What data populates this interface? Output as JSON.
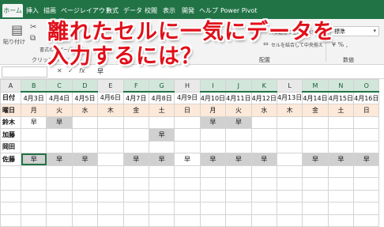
{
  "ribbon": {
    "tabs": [
      "ホーム",
      "挿入",
      "描画",
      "ページレイアウト",
      "数式",
      "データ",
      "校閲",
      "表示",
      "開発",
      "ヘルプ",
      "Power Pivot"
    ],
    "active_tab": "ホーム",
    "paste_label": "貼り付け",
    "format_copy_label": "書式のコピー/貼り付け",
    "clipboard_group": "クリップボード",
    "wrap_label": "折り返して全体を表示する",
    "merge_label": "セルを結合して中央揃え",
    "align_group": "配置",
    "number_format": "標準",
    "number_group": "数値"
  },
  "formula_bar": {
    "name_box": "",
    "value": "早"
  },
  "headline": {
    "line1": "離れたセルに一気にデータを",
    "line2": "入力するには？"
  },
  "sheet": {
    "column_headers": [
      "A",
      "B",
      "C",
      "D",
      "E",
      "F",
      "G",
      "H",
      "I",
      "J",
      "K",
      "L",
      "M",
      "N",
      "O"
    ],
    "selected_columns": [
      "B",
      "C",
      "D",
      "F",
      "G",
      "I",
      "J",
      "K",
      "M",
      "N",
      "O"
    ],
    "row_labels": [
      "日付",
      "曜日",
      "鈴木",
      "加藤",
      "岡田",
      "佐藤"
    ],
    "dates": [
      "4月3日",
      "4月4日",
      "4月5日",
      "4月6日",
      "4月7日",
      "4月8日",
      "4月9日",
      "4月10日",
      "4月11日",
      "4月12日",
      "4月13日",
      "4月14日",
      "4月15日",
      "4月16日"
    ],
    "weekdays": [
      "月",
      "火",
      "水",
      "木",
      "金",
      "土",
      "日",
      "月",
      "火",
      "水",
      "木",
      "金",
      "土",
      "日"
    ],
    "people": [
      [
        "早",
        "早",
        "",
        "",
        "",
        "",
        "",
        "早",
        "早",
        "",
        "",
        "",
        "",
        ""
      ],
      [
        "",
        "",
        "",
        "",
        "",
        "早",
        "",
        "",
        "",
        "",
        "",
        "",
        "",
        ""
      ],
      [
        "",
        "",
        "",
        "",
        "",
        "",
        "",
        "",
        "",
        "",
        "",
        "",
        "",
        ""
      ],
      [
        "早",
        "早",
        "早",
        "",
        "早",
        "早",
        "早",
        "早",
        "早",
        "早",
        "",
        "早",
        "早",
        "早"
      ]
    ],
    "gray_cells": {
      "鈴木": [
        1,
        7,
        8
      ],
      "加藤": [
        5
      ],
      "佐藤": [
        0,
        1,
        2,
        4,
        5,
        7,
        8,
        9,
        11,
        12,
        13
      ]
    },
    "active_cell": "佐藤-0"
  },
  "colors": {
    "excel_green": "#217346",
    "headline_red": "#e0101a",
    "weekday_fill": "#fde9d9",
    "selection_gray": "#d0d0d0"
  }
}
